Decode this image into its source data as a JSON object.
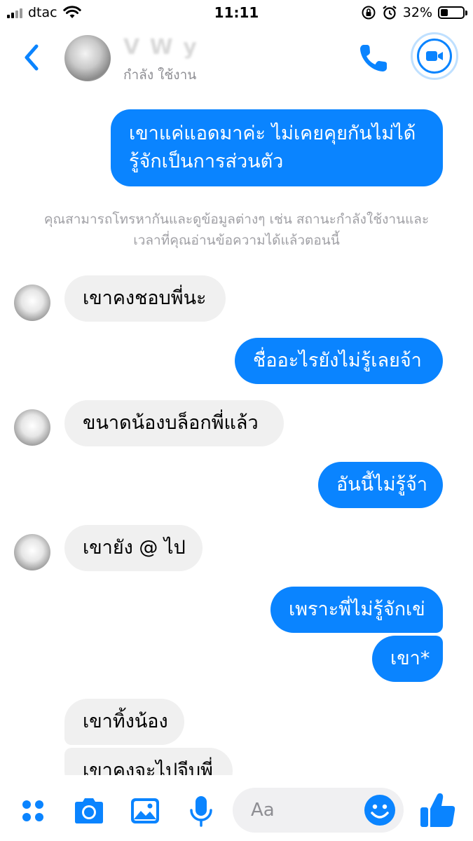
{
  "status_bar": {
    "carrier": "dtac",
    "time": "11:11",
    "battery_percent": "32%",
    "battery_level": 0.32
  },
  "header": {
    "contact_name": "V        W   y",
    "contact_status": "กำลัง ใช้งาน",
    "icons": [
      "chevron-left-icon",
      "phone-icon",
      "video-camera-icon"
    ]
  },
  "messages": {
    "out_1_line1": "เขาแค่แอดมาค่ะ ไม่เคยคุยกันไม่ได้",
    "out_1_line2": "รู้จักเป็นการส่วนตัว",
    "notice_line1": "คุณสามารถโทรหากันและดูข้อมูลต่างๆ เช่น สถานะกำลังใช้งานและ",
    "notice_line2": "เวลาที่คุณอ่านข้อความได้แล้วตอนนี้",
    "in_1": "เขาคงชอบพี่นะ",
    "out_2": "ชื่ออะไรยังไม่รู้เลยจ้า",
    "in_2": "ขนาดน้องบล็อกพี่แล้ว",
    "out_3": "อันนี้ไม่รู้จ้า",
    "in_3": "เขายัง @ ไป",
    "out_4": "เพราะพี่ไม่รู้จักเข่",
    "out_5": "เขา*",
    "in_4": "เขาทิ้งน้อง",
    "in_5": "เขาคงจะไปจีบพี่"
  },
  "composer": {
    "placeholder": "Aa",
    "icons": [
      "apps-grid-icon",
      "camera-icon",
      "image-icon",
      "microphone-icon",
      "emoji-icon",
      "thumbs-up-icon"
    ]
  },
  "colors": {
    "accent": "#0a84ff",
    "incoming_bubble": "#f0f0f0",
    "muted_text": "#8e8e93"
  }
}
